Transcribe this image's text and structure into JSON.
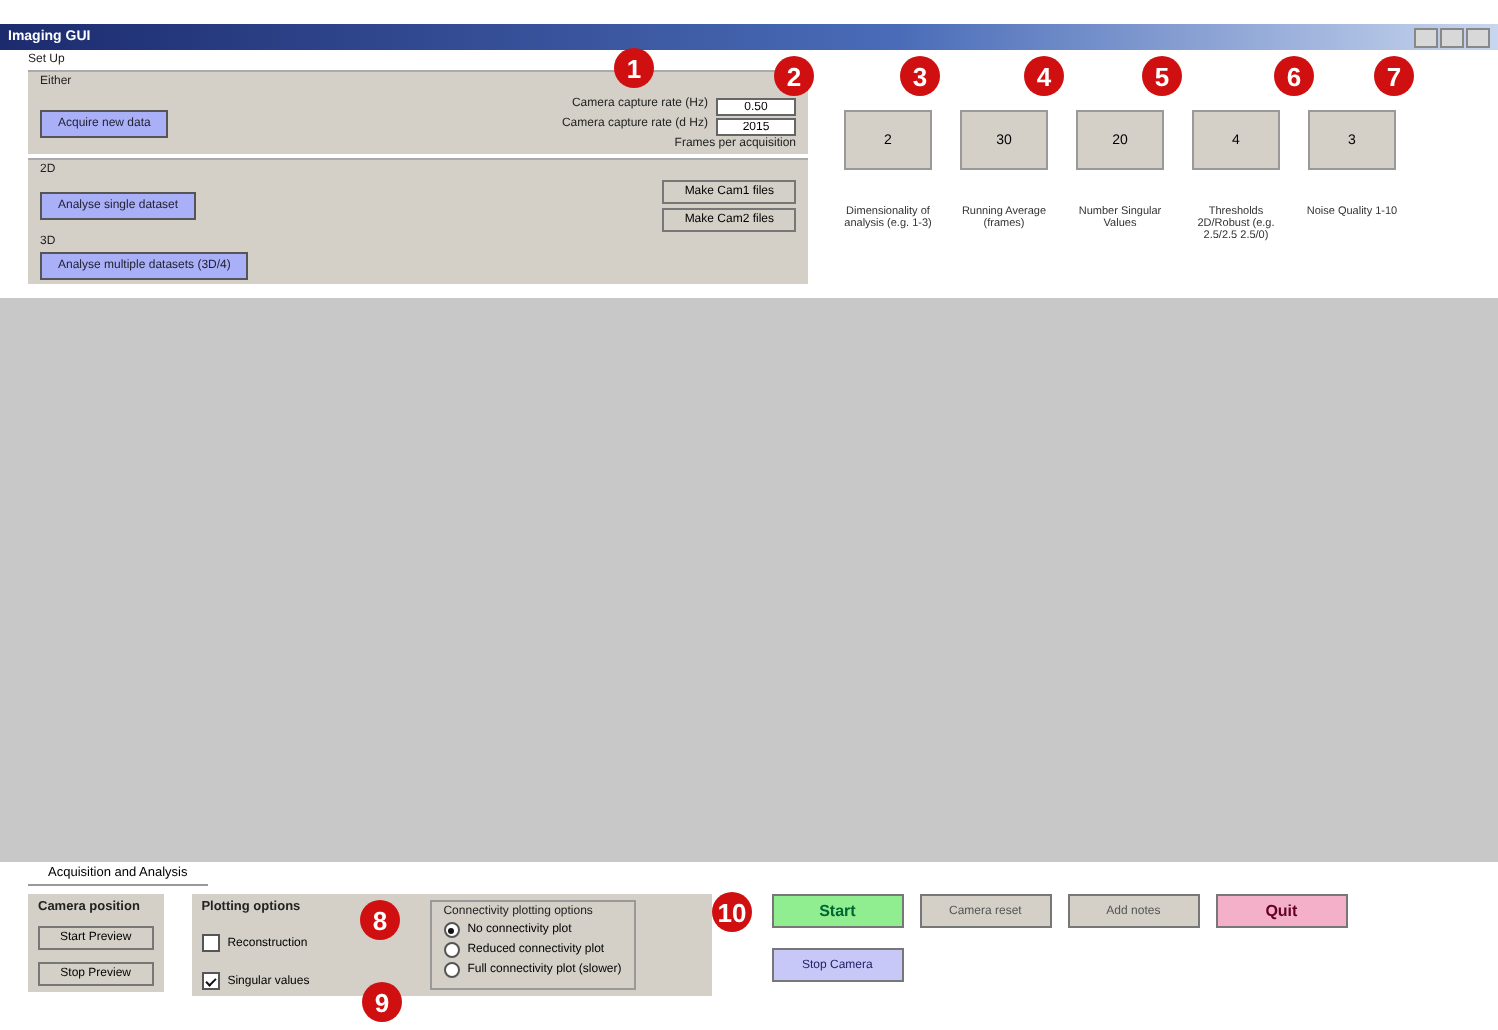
{
  "window": {
    "title": "Imaging GUI"
  },
  "setup": {
    "title": "Set Up",
    "either": {
      "title": "Either",
      "button": "Acquire new data",
      "fields": [
        {
          "label": "Camera capture rate (Hz)",
          "value": "0.50"
        },
        {
          "label": "Camera capture rate (d Hz)",
          "value": "2015"
        }
      ],
      "note": "Frames per acquisition"
    },
    "single": {
      "title": "2D",
      "button": "Analyse single dataset",
      "side_buttons": [
        "Make Cam1 files",
        "Make Cam2 files"
      ]
    },
    "multi": {
      "title": "3D",
      "button": "Analyse multiple datasets (3D/4)"
    },
    "params": [
      {
        "value": "2",
        "label": "Dimensionality of analysis (e.g. 1-3)"
      },
      {
        "value": "30",
        "label": "Running Average (frames)"
      },
      {
        "value": "20",
        "label": "Number Singular Values"
      },
      {
        "value": "4",
        "label": "Thresholds 2D/Robust (e.g. 2.5/2.5 2.5/0)"
      },
      {
        "value": "3",
        "label": "Noise Quality 1-10"
      }
    ]
  },
  "acquisition": {
    "tab": "Acquisition and Analysis",
    "camera_position": {
      "title": "Camera position",
      "buttons": [
        "Start Preview",
        "Stop Preview"
      ]
    },
    "plotting": {
      "title": "Plotting options",
      "checkboxes": [
        {
          "label": "Reconstruction",
          "checked": false
        },
        {
          "label": "Singular values",
          "checked": true
        }
      ],
      "connectivity": {
        "title": "Connectivity plotting options",
        "options": [
          {
            "label": "No connectivity plot",
            "selected": true
          },
          {
            "label": "Reduced connectivity plot",
            "selected": false
          },
          {
            "label": "Full connectivity plot (slower)",
            "selected": false
          }
        ]
      }
    },
    "buttons": [
      {
        "label": "Start",
        "kind": "start"
      },
      {
        "label": "Camera reset",
        "kind": "plain"
      },
      {
        "label": "Add notes",
        "kind": "plain"
      },
      {
        "label": "Quit",
        "kind": "quit"
      },
      {
        "label": "Stop Camera",
        "kind": "stop"
      }
    ]
  },
  "markers": [
    "1",
    "2",
    "3",
    "4",
    "5",
    "6",
    "7",
    "8",
    "9",
    "10"
  ]
}
